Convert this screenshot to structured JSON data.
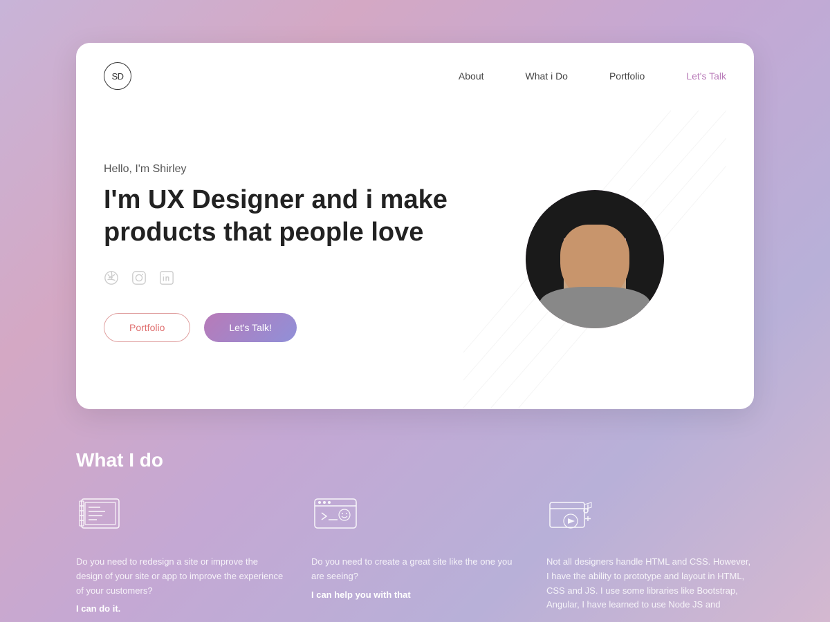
{
  "logo": {
    "text": "SD"
  },
  "nav": {
    "links": [
      {
        "label": "About",
        "active": false
      },
      {
        "label": "What i Do",
        "active": false
      },
      {
        "label": "Portfolio",
        "active": false
      },
      {
        "label": "Let's Talk",
        "active": true
      }
    ]
  },
  "hero": {
    "greeting": "Hello, I'm Shirley",
    "title": "I'm UX Designer and i make products that people love",
    "social": [
      {
        "name": "dribbble-icon"
      },
      {
        "name": "instagram-icon"
      },
      {
        "name": "linkedin-icon"
      }
    ],
    "portfolio_btn": "Portfolio",
    "letstalk_btn": "Let's Talk!"
  },
  "what_i_do": {
    "section_title": "What I do",
    "services": [
      {
        "desc": "Do you need to redesign a site or improve the design of your site or app to improve the experience of your customers?",
        "cta": "I can do it."
      },
      {
        "desc": "Do you need to create a great site like the one you are seeing?",
        "cta": "I can help you with that"
      },
      {
        "desc": "Not all designers handle HTML and CSS. However, I have the ability to prototype and layout in HTML, CSS and JS. I use some libraries like Bootstrap, Angular, I have learned to use Node JS and",
        "cta": ""
      }
    ]
  }
}
